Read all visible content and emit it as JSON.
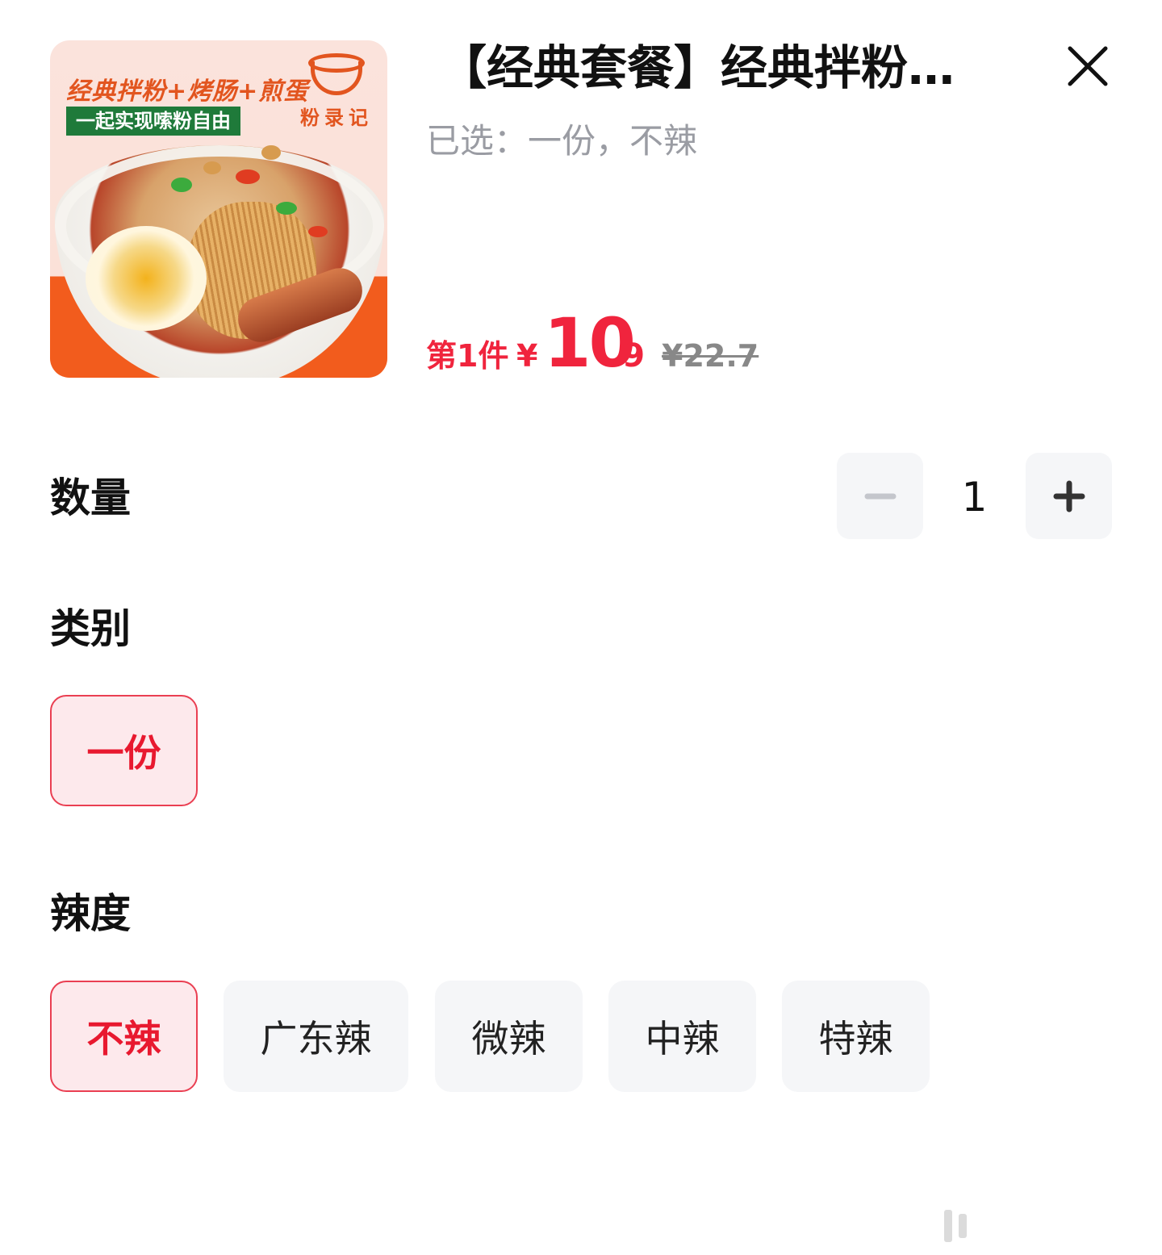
{
  "product": {
    "title": "【经典套餐】经典拌粉…",
    "selected": "已选：一份，不辣",
    "image": {
      "headline": "经典拌粉+烤肠+煎蛋",
      "tagline": "一起实现嗦粉自由",
      "brand": "粉录记"
    }
  },
  "price": {
    "prefix": "第1件",
    "currency": "¥",
    "integer": "10",
    "decimal": ".9",
    "original": "¥22.7",
    "color": "#f0243d"
  },
  "quantity": {
    "label": "数量",
    "value": "1",
    "decrease_icon": "minus-icon",
    "increase_icon": "plus-icon"
  },
  "category": {
    "label": "类别",
    "options": [
      {
        "label": "一份",
        "selected": true
      }
    ]
  },
  "spice": {
    "label": "辣度",
    "options": [
      {
        "label": "不辣",
        "selected": true
      },
      {
        "label": "广东辣",
        "selected": false
      },
      {
        "label": "微辣",
        "selected": false
      },
      {
        "label": "中辣",
        "selected": false
      },
      {
        "label": "特辣",
        "selected": false
      }
    ]
  },
  "icons": {
    "close": "close-icon"
  },
  "colors": {
    "accent": "#ea3f52",
    "selected_bg": "#fde9ec",
    "chip_bg": "#f5f6f8"
  }
}
